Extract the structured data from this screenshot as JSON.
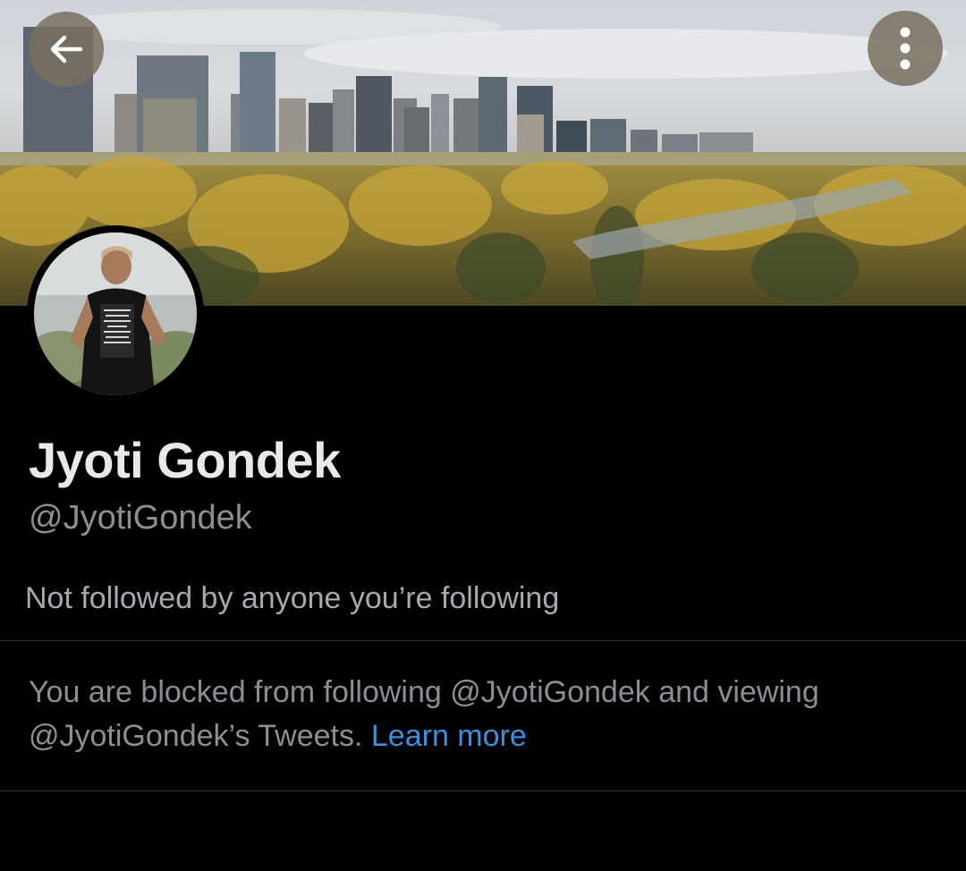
{
  "header": {
    "back_icon": "arrow-left-icon",
    "more_icon": "more-vertical-icon",
    "button_color": "#786e5f"
  },
  "profile": {
    "display_name": "Jyoti Gondek",
    "handle": "@JyotiGondek",
    "followed_by": "Not followed by anyone you’re following"
  },
  "blocked_notice": {
    "text": "You are blocked from following @JyotiGondek and viewing @JyotiGondek’s Tweets.",
    "learn_more_label": "Learn more",
    "link_color": "#3d8fdb"
  }
}
